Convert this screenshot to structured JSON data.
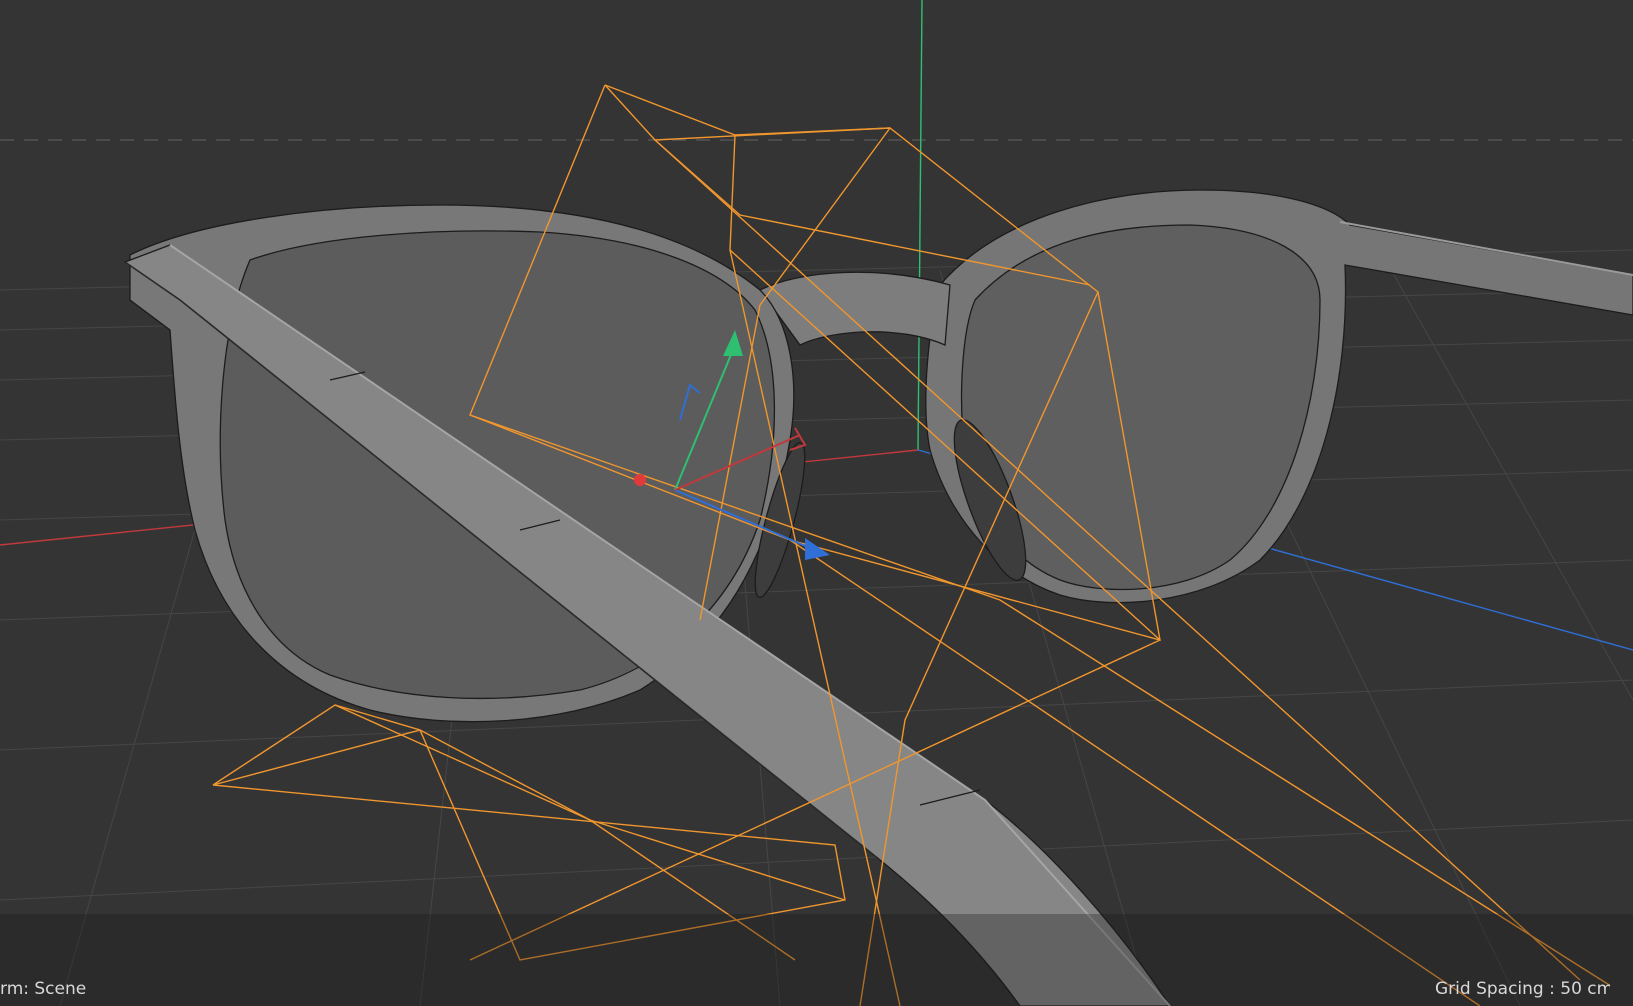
{
  "viewport": {
    "camera_label": "rm: Scene",
    "grid_spacing_label": "Grid Spacing : 50 cm"
  },
  "colors": {
    "background": "#343434",
    "grid_line": "#454545",
    "horizon_dash": "#5a5a5a",
    "axis_x": "#c0393b",
    "axis_y": "#2fbf71",
    "axis_z": "#2f6fd6",
    "selection_wire": "#f0962e",
    "model_face": "#7a7a7a",
    "model_edge": "#1c1c1c"
  },
  "icons": {
    "gizmo": "move-gizmo-icon",
    "pivot": "pivot-point-icon"
  }
}
